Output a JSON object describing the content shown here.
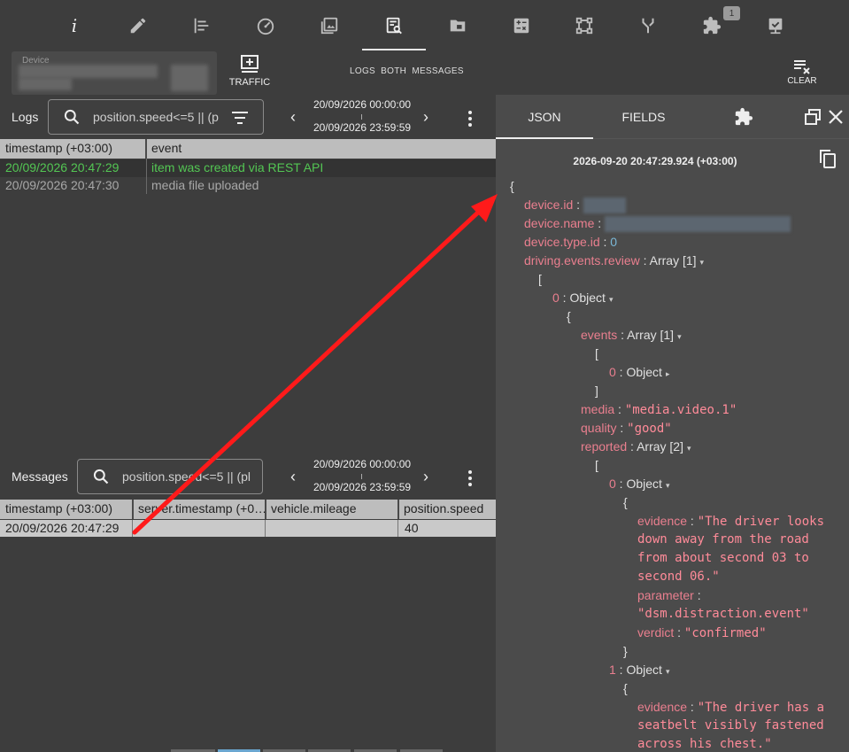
{
  "toolbar": {
    "icons": [
      {
        "name": "info-icon",
        "glyph": "i"
      },
      {
        "name": "pencil-icon"
      },
      {
        "name": "sliders-icon"
      },
      {
        "name": "speedometer-icon"
      },
      {
        "name": "media-icon"
      },
      {
        "name": "log-search-icon",
        "active": true
      },
      {
        "name": "folder-icon"
      },
      {
        "name": "calculator-icon"
      },
      {
        "name": "network-icon"
      },
      {
        "name": "fork-icon"
      },
      {
        "name": "puzzle-icon",
        "badge": "1"
      },
      {
        "name": "device-check-icon"
      }
    ]
  },
  "device": {
    "label": "Device"
  },
  "traffic": {
    "label": "TRAFFIC"
  },
  "mode": {
    "logs": "LOGS",
    "both": "BOTH",
    "messages": "MESSAGES"
  },
  "clear": {
    "label": "CLEAR"
  },
  "logs": {
    "label": "Logs",
    "search_value": "position.speed<=5 || (p",
    "date_from": "20/09/2026 00:00:00",
    "date_to": "20/09/2026 23:59:59",
    "columns": [
      "timestamp (+03:00)",
      "event"
    ],
    "rows": [
      {
        "timestamp": "20/09/2026 20:47:29",
        "event": "item was created via REST API",
        "highlight": true
      },
      {
        "timestamp": "20/09/2026 20:47:30",
        "event": "media file uploaded",
        "highlight": false
      }
    ]
  },
  "messages": {
    "label": "Messages",
    "search_value": "position.speed<=5 || (pl",
    "date_from": "20/09/2026 00:00:00",
    "date_to": "20/09/2026 23:59:59",
    "columns": [
      "timestamp (+03:00)",
      "server.timestamp (+0…",
      "vehicle.mileage",
      "position.speed"
    ],
    "rows": [
      {
        "timestamp": "20/09/2026 20:47:29",
        "server_timestamp": "",
        "mileage": "",
        "speed": "40"
      }
    ]
  },
  "panel": {
    "tabs": [
      "JSON",
      "FIELDS"
    ],
    "timestamp": "2026-09-20 20:47:29.924 (+03:00)",
    "json": {
      "open_brace": "{",
      "device_id_key": "device.id",
      "device_name_key": "device.name",
      "device_type_id_key": "device.type.id",
      "device_type_id_val": "0",
      "review_key": "driving.events.review",
      "array1": "Array [1]",
      "open_bracket": "[",
      "idx0": "0",
      "object": "Object",
      "events_key": "events",
      "events_arr": "Array [1]",
      "close_bracket": "]",
      "close_brace": "}",
      "media_key": "media",
      "media_val": "\"media.video.1\"",
      "quality_key": "quality",
      "quality_val": "\"good\"",
      "reported_key": "reported",
      "reported_arr": "Array [2]",
      "idx1": "1",
      "evidence_key": "evidence",
      "evidence0_l1": "\"The driver looks",
      "evidence0_l2": "down away from the road",
      "evidence0_l3": "from about second 03 to",
      "evidence0_l4": "second 06.\"",
      "parameter_key": "parameter",
      "parameter_val": "\"dsm.distraction.event\"",
      "verdict_key": "verdict",
      "verdict_val": "\"confirmed\"",
      "evidence1_l1": "\"The driver has a",
      "evidence1_l2": "seatbelt visibly fastened",
      "evidence1_l3": "across his chest.\""
    }
  },
  "colors": {
    "accent_red": "#ff1a1a",
    "log_highlight_text": "#53c653",
    "json_key": "#ea7f8f",
    "json_string": "#ff8b99",
    "json_number": "#7ab8d8"
  }
}
